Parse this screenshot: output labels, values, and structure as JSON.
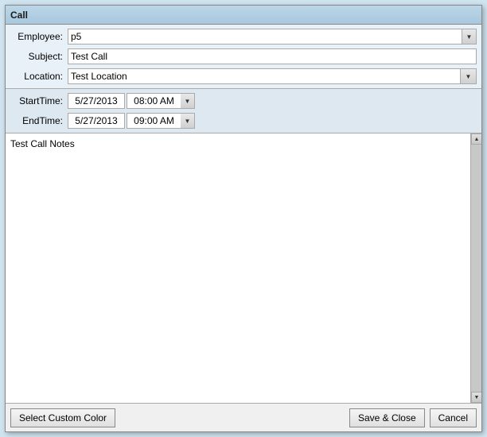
{
  "titleBar": {
    "title": "Call"
  },
  "form": {
    "employeeLabel": "Employee:",
    "employeeValue": "p5",
    "subjectLabel": "Subject:",
    "subjectValue": "Test Call",
    "locationLabel": "Location:",
    "locationValue": "Test Location"
  },
  "times": {
    "startLabel": "StartTime:",
    "startDate": "5/27/2013",
    "startTime": "08:00 AM",
    "endLabel": "EndTime:",
    "endDate": "5/27/2013",
    "endTime": "09:00 AM"
  },
  "notes": {
    "value": "Test Call Notes"
  },
  "buttons": {
    "customColor": "Select Custom Color",
    "saveClose": "Save & Close",
    "cancel": "Cancel"
  }
}
